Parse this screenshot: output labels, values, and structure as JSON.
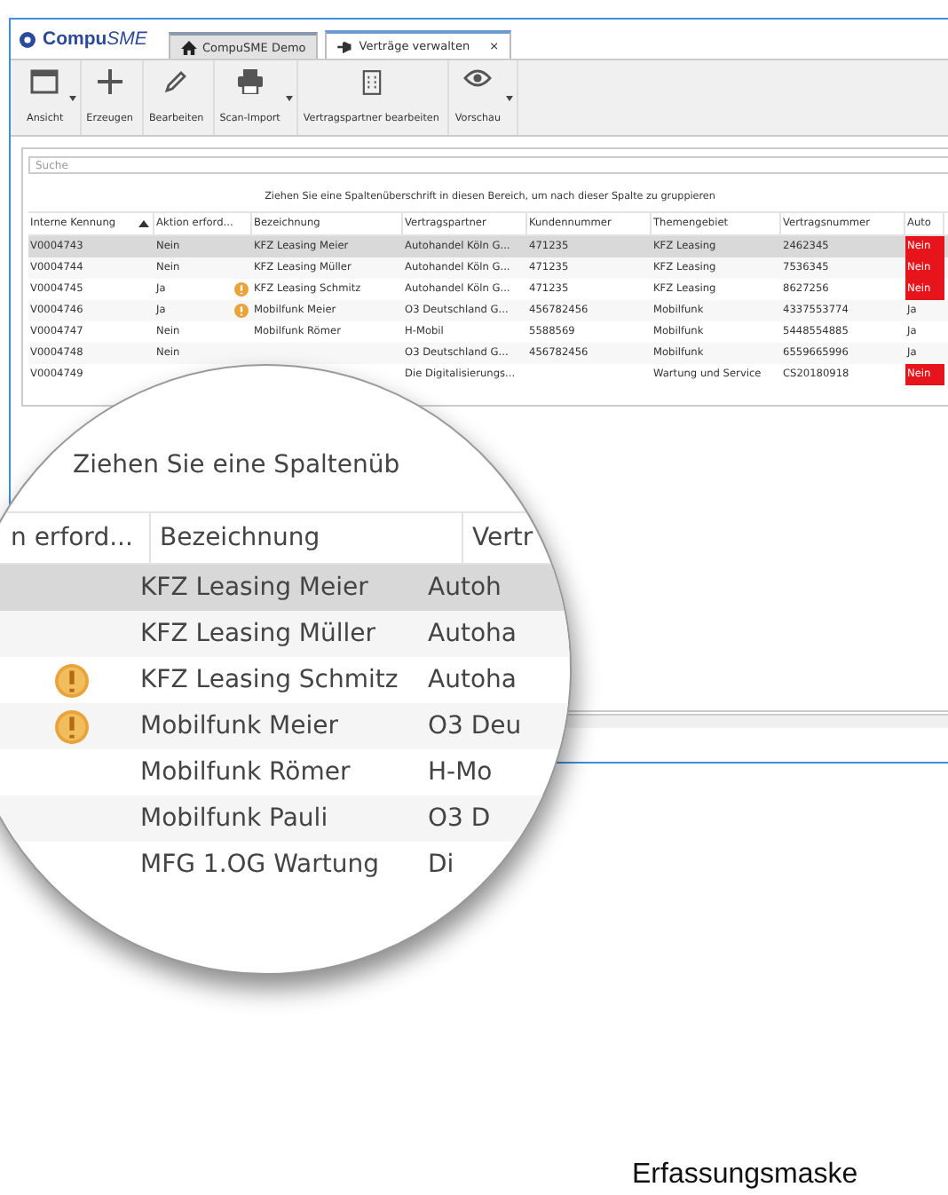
{
  "app": {
    "logo_main": "Compu",
    "logo_sub": "SME"
  },
  "tabs": [
    {
      "label": "CompuSME Demo",
      "kind": "home",
      "selected": false
    },
    {
      "label": "Verträge verwalten",
      "kind": "pin",
      "selected": true,
      "close": "×"
    }
  ],
  "toolbar": [
    {
      "label": "Ansicht",
      "kind": "window",
      "dropdown": true
    },
    {
      "label": "Erzeugen",
      "kind": "plus",
      "dropdown": false
    },
    {
      "label": "Bearbeiten",
      "kind": "pencil",
      "dropdown": false
    },
    {
      "label": "Scan-Import",
      "kind": "printer",
      "dropdown": true
    },
    {
      "label": "Vertragspartner bearbeiten",
      "kind": "building",
      "dropdown": false
    },
    {
      "label": "Vorschau",
      "kind": "eye",
      "dropdown": true
    }
  ],
  "search": {
    "placeholder": "Suche"
  },
  "group_hint": "Ziehen Sie eine Spaltenüberschrift in diesen Bereich, um nach dieser Spalte zu gruppieren",
  "table": {
    "columns": [
      {
        "label": "Interne Kennung",
        "sorted": true
      },
      {
        "label": "Aktion erford...",
        "sorted": false
      },
      {
        "label": "Bezeichnung",
        "sorted": false
      },
      {
        "label": "Vertragspartner",
        "sorted": false
      },
      {
        "label": "Kundennummer",
        "sorted": false
      },
      {
        "label": "Themengebiet",
        "sorted": false
      },
      {
        "label": "Vertragsnummer",
        "sorted": false
      },
      {
        "label": "Auto",
        "sorted": false
      }
    ],
    "rows": [
      {
        "selected": true,
        "warning": false,
        "alert": true,
        "cells": [
          "V0004743",
          "Nein",
          "KFZ Leasing Meier",
          "Autohandel Köln G...",
          "471235",
          "KFZ Leasing",
          "2462345",
          "Nein"
        ]
      },
      {
        "selected": false,
        "warning": false,
        "alert": true,
        "cells": [
          "V0004744",
          "Nein",
          "KFZ Leasing Müller",
          "Autohandel Köln G...",
          "471235",
          "KFZ Leasing",
          "7536345",
          "Nein"
        ]
      },
      {
        "selected": false,
        "warning": true,
        "alert": true,
        "cells": [
          "V0004745",
          "Ja",
          "KFZ Leasing Schmitz",
          "Autohandel Köln G...",
          "471235",
          "KFZ Leasing",
          "8627256",
          "Nein"
        ]
      },
      {
        "selected": false,
        "warning": true,
        "alert": false,
        "cells": [
          "V0004746",
          "Ja",
          "Mobilfunk Meier",
          "O3 Deutschland G...",
          "456782456",
          "Mobilfunk",
          "4337553774",
          "Ja"
        ]
      },
      {
        "selected": false,
        "warning": false,
        "alert": false,
        "cells": [
          "V0004747",
          "Nein",
          "Mobilfunk Römer",
          "H-Mobil",
          "5588569",
          "Mobilfunk",
          "5448554885",
          "Ja"
        ]
      },
      {
        "selected": false,
        "warning": false,
        "alert": false,
        "cells": [
          "V0004748",
          "Nein",
          null,
          "O3 Deutschland G...",
          "456782456",
          "Mobilfunk",
          "6559665996",
          "Ja"
        ]
      },
      {
        "selected": false,
        "warning": false,
        "alert": true,
        "cells": [
          "V0004749",
          null,
          null,
          "Die Digitalisierungs...",
          null,
          "Wartung und Service",
          "CS20180918",
          "Nein"
        ]
      }
    ]
  },
  "magnifier": {
    "group_hint": "Ziehen Sie eine Spaltenüb",
    "columns": [
      "n erford...",
      "Bezeichnung",
      "Vertr"
    ],
    "rows": [
      {
        "selected": true,
        "warning": false,
        "name": "KFZ Leasing Meier",
        "partner": "Autoh"
      },
      {
        "selected": false,
        "warning": false,
        "name": "KFZ Leasing Müller",
        "partner": "Autoha"
      },
      {
        "selected": false,
        "warning": true,
        "name": "KFZ Leasing Schmitz",
        "partner": "Autoha"
      },
      {
        "selected": false,
        "warning": true,
        "name": "Mobilfunk Meier",
        "partner": "O3 Deu"
      },
      {
        "selected": false,
        "warning": false,
        "name": "Mobilfunk Römer",
        "partner": "H-Mo"
      },
      {
        "selected": false,
        "warning": false,
        "name": "Mobilfunk Pauli",
        "partner": "O3 D"
      },
      {
        "selected": false,
        "warning": false,
        "name": "MFG 1.OG Wartung",
        "partner": "Di"
      }
    ]
  },
  "caption": "Erfassungsmaske"
}
